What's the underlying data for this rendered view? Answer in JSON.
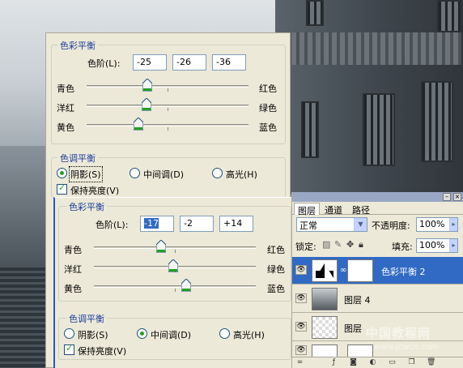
{
  "back_dialog": {
    "color_balance": {
      "legend": "色彩平衡",
      "levels_label": "色阶(L):",
      "levels": [
        "-25",
        "-26",
        "-36"
      ],
      "sliders": [
        {
          "left": "青色",
          "right": "红色",
          "value": -25
        },
        {
          "left": "洋红",
          "right": "绿色",
          "value": -26
        },
        {
          "left": "黄色",
          "right": "蓝色",
          "value": -36
        }
      ]
    },
    "tone_balance": {
      "legend": "色调平衡",
      "options": [
        "阴影(S)",
        "中间调(D)",
        "高光(H)"
      ],
      "selected": "阴影(S)",
      "preserve_luminosity": "保持亮度(V)",
      "preserve_checked": true
    }
  },
  "front_dialog": {
    "color_balance": {
      "legend": "色彩平衡",
      "levels_label": "色阶(L):",
      "levels": [
        "-17",
        "-2",
        "+14"
      ],
      "sliders": [
        {
          "left": "青色",
          "right": "红色",
          "value": -17
        },
        {
          "left": "洋红",
          "right": "绿色",
          "value": -2
        },
        {
          "left": "黄色",
          "right": "蓝色",
          "value": 14
        }
      ]
    },
    "tone_balance": {
      "legend": "色调平衡",
      "options": [
        "阴影(S)",
        "中间调(D)",
        "高光(H)"
      ],
      "selected": "中间调(D)",
      "preserve_luminosity": "保持亮度(V)",
      "preserve_checked": true
    }
  },
  "layers_panel": {
    "tabs": [
      "图层",
      "通道",
      "路径"
    ],
    "active_tab": "图层",
    "blend_mode": "正常",
    "opacity_label": "不透明度:",
    "opacity": "100%",
    "lock_label": "锁定:",
    "fill_label": "填充:",
    "fill": "100%",
    "layers": [
      {
        "name": "色彩平衡 2",
        "type": "adjustment",
        "selected": true
      },
      {
        "name": "图层 4",
        "type": "image",
        "selected": false
      },
      {
        "name": "图层",
        "type": "transparent",
        "selected": false
      }
    ]
  },
  "watermark": {
    "line1": "中国教程网",
    "line2": "www.jcwcn.com"
  }
}
